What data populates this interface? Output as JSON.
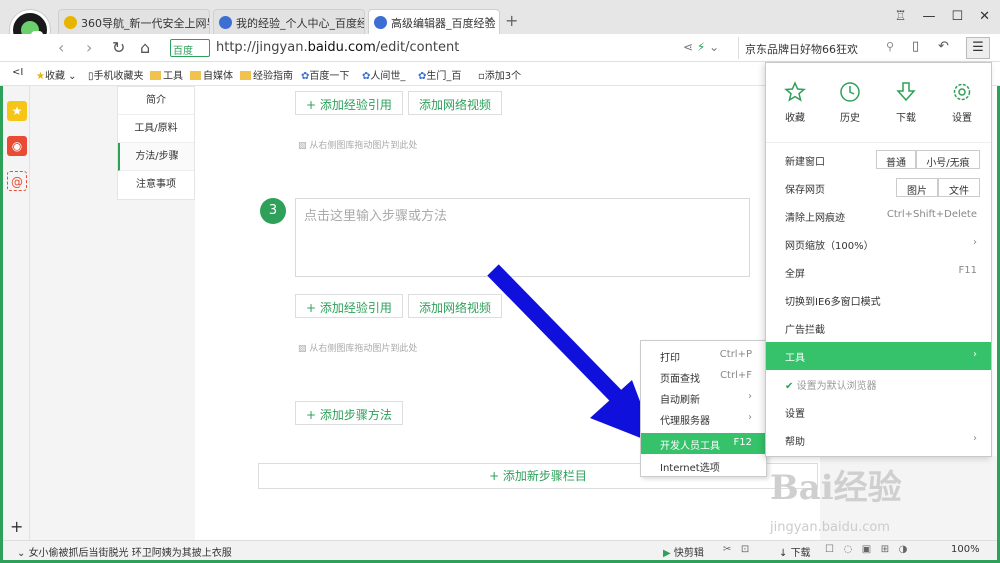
{
  "tabs": [
    {
      "label": "360导航_新一代安全上网导",
      "active": false,
      "icon_color": "#e8b400"
    },
    {
      "label": "我的经验_个人中心_百度经",
      "active": false,
      "icon_color": "#3b6fd4"
    },
    {
      "label": "高级编辑器_百度经验",
      "active": true,
      "icon_color": "#3b6fd4"
    }
  ],
  "toolbar": {
    "baidu_badge": "百度",
    "url_prefix": "http://jingyan.",
    "url_domain": "baidu.com",
    "url_path": "/edit/content",
    "search_text": "京东品牌日好物66狂欢"
  },
  "bookmarks": [
    "收藏",
    "手机收藏夹",
    "工具",
    "自媒体",
    "经验指南",
    "百度一下",
    "人间世_",
    "生门_百",
    "添加3个"
  ],
  "stepnav": [
    "简介",
    "工具/原料",
    "方法/步骤",
    "注意事项"
  ],
  "editor": {
    "add_ref": "+ 添加经验引用",
    "add_video": "添加网络视频",
    "drag_hint": "从右侧图库拖动图片到此处",
    "step_number": "3",
    "step_placeholder": "点击这里输入步骤或方法",
    "add_step": "+ 添加步骤方法",
    "add_column": "+ 添加新步骤栏目"
  },
  "context_menu": [
    {
      "label": "打印",
      "key": "Ctrl+P"
    },
    {
      "label": "页面查找",
      "key": "Ctrl+F"
    },
    {
      "label": "自动刷新",
      "key": "›"
    },
    {
      "label": "代理服务器",
      "key": "›"
    },
    {
      "label": "开发人员工具",
      "key": "F12",
      "highlight": true
    },
    {
      "label": "Internet选项",
      "key": ""
    }
  ],
  "main_menu": {
    "top": [
      "收藏",
      "历史",
      "下载",
      "设置"
    ],
    "new_window": "新建窗口",
    "nw_normal": "普通",
    "nw_small": "小号/无痕",
    "save_page": "保存网页",
    "sp_image": "图片",
    "sp_file": "文件",
    "clear": "清除上网痕迹",
    "clear_key": "Ctrl+Shift+Delete",
    "zoom": "网页缩放（100%）",
    "fullscreen": "全屏",
    "fullscreen_key": "F11",
    "ie6": "切换到IE6多窗口模式",
    "adblock": "广告拦截",
    "tools": "工具",
    "default_browser": "设置为默认浏览器",
    "settings": "设置",
    "help": "帮助",
    "arrow": "›"
  },
  "status": {
    "news": "女小偷被抓后当街脱光 环卫阿姨为其披上衣服",
    "quick": "快剪辑",
    "download": "下载",
    "zoom": "100%"
  },
  "watermark": {
    "brand": "Bai经验",
    "url": "jingyan.baidu.com"
  },
  "colors": {
    "green": "#2ea05a",
    "highlight": "#35c26a",
    "arrow": "#1010dd"
  }
}
